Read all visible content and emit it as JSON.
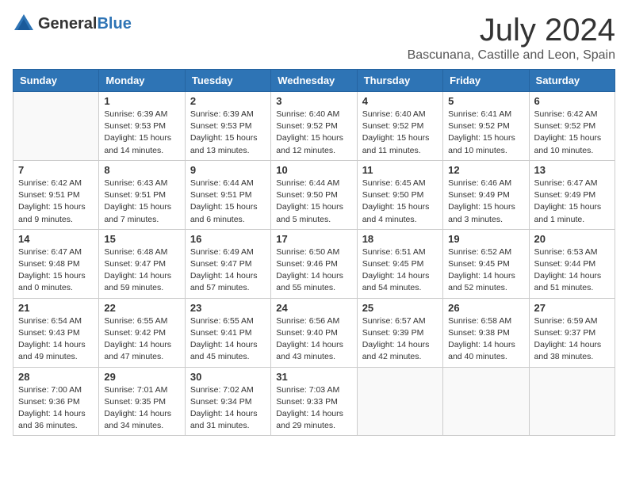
{
  "logo": {
    "general": "General",
    "blue": "Blue"
  },
  "title": {
    "month": "July 2024",
    "location": "Bascunana, Castille and Leon, Spain"
  },
  "days_of_week": [
    "Sunday",
    "Monday",
    "Tuesday",
    "Wednesday",
    "Thursday",
    "Friday",
    "Saturday"
  ],
  "weeks": [
    [
      {
        "day": "",
        "sunrise": "",
        "sunset": "",
        "daylight": ""
      },
      {
        "day": "1",
        "sunrise": "Sunrise: 6:39 AM",
        "sunset": "Sunset: 9:53 PM",
        "daylight": "Daylight: 15 hours and 14 minutes."
      },
      {
        "day": "2",
        "sunrise": "Sunrise: 6:39 AM",
        "sunset": "Sunset: 9:53 PM",
        "daylight": "Daylight: 15 hours and 13 minutes."
      },
      {
        "day": "3",
        "sunrise": "Sunrise: 6:40 AM",
        "sunset": "Sunset: 9:52 PM",
        "daylight": "Daylight: 15 hours and 12 minutes."
      },
      {
        "day": "4",
        "sunrise": "Sunrise: 6:40 AM",
        "sunset": "Sunset: 9:52 PM",
        "daylight": "Daylight: 15 hours and 11 minutes."
      },
      {
        "day": "5",
        "sunrise": "Sunrise: 6:41 AM",
        "sunset": "Sunset: 9:52 PM",
        "daylight": "Daylight: 15 hours and 10 minutes."
      },
      {
        "day": "6",
        "sunrise": "Sunrise: 6:42 AM",
        "sunset": "Sunset: 9:52 PM",
        "daylight": "Daylight: 15 hours and 10 minutes."
      }
    ],
    [
      {
        "day": "7",
        "sunrise": "Sunrise: 6:42 AM",
        "sunset": "Sunset: 9:51 PM",
        "daylight": "Daylight: 15 hours and 9 minutes."
      },
      {
        "day": "8",
        "sunrise": "Sunrise: 6:43 AM",
        "sunset": "Sunset: 9:51 PM",
        "daylight": "Daylight: 15 hours and 7 minutes."
      },
      {
        "day": "9",
        "sunrise": "Sunrise: 6:44 AM",
        "sunset": "Sunset: 9:51 PM",
        "daylight": "Daylight: 15 hours and 6 minutes."
      },
      {
        "day": "10",
        "sunrise": "Sunrise: 6:44 AM",
        "sunset": "Sunset: 9:50 PM",
        "daylight": "Daylight: 15 hours and 5 minutes."
      },
      {
        "day": "11",
        "sunrise": "Sunrise: 6:45 AM",
        "sunset": "Sunset: 9:50 PM",
        "daylight": "Daylight: 15 hours and 4 minutes."
      },
      {
        "day": "12",
        "sunrise": "Sunrise: 6:46 AM",
        "sunset": "Sunset: 9:49 PM",
        "daylight": "Daylight: 15 hours and 3 minutes."
      },
      {
        "day": "13",
        "sunrise": "Sunrise: 6:47 AM",
        "sunset": "Sunset: 9:49 PM",
        "daylight": "Daylight: 15 hours and 1 minute."
      }
    ],
    [
      {
        "day": "14",
        "sunrise": "Sunrise: 6:47 AM",
        "sunset": "Sunset: 9:48 PM",
        "daylight": "Daylight: 15 hours and 0 minutes."
      },
      {
        "day": "15",
        "sunrise": "Sunrise: 6:48 AM",
        "sunset": "Sunset: 9:47 PM",
        "daylight": "Daylight: 14 hours and 59 minutes."
      },
      {
        "day": "16",
        "sunrise": "Sunrise: 6:49 AM",
        "sunset": "Sunset: 9:47 PM",
        "daylight": "Daylight: 14 hours and 57 minutes."
      },
      {
        "day": "17",
        "sunrise": "Sunrise: 6:50 AM",
        "sunset": "Sunset: 9:46 PM",
        "daylight": "Daylight: 14 hours and 55 minutes."
      },
      {
        "day": "18",
        "sunrise": "Sunrise: 6:51 AM",
        "sunset": "Sunset: 9:45 PM",
        "daylight": "Daylight: 14 hours and 54 minutes."
      },
      {
        "day": "19",
        "sunrise": "Sunrise: 6:52 AM",
        "sunset": "Sunset: 9:45 PM",
        "daylight": "Daylight: 14 hours and 52 minutes."
      },
      {
        "day": "20",
        "sunrise": "Sunrise: 6:53 AM",
        "sunset": "Sunset: 9:44 PM",
        "daylight": "Daylight: 14 hours and 51 minutes."
      }
    ],
    [
      {
        "day": "21",
        "sunrise": "Sunrise: 6:54 AM",
        "sunset": "Sunset: 9:43 PM",
        "daylight": "Daylight: 14 hours and 49 minutes."
      },
      {
        "day": "22",
        "sunrise": "Sunrise: 6:55 AM",
        "sunset": "Sunset: 9:42 PM",
        "daylight": "Daylight: 14 hours and 47 minutes."
      },
      {
        "day": "23",
        "sunrise": "Sunrise: 6:55 AM",
        "sunset": "Sunset: 9:41 PM",
        "daylight": "Daylight: 14 hours and 45 minutes."
      },
      {
        "day": "24",
        "sunrise": "Sunrise: 6:56 AM",
        "sunset": "Sunset: 9:40 PM",
        "daylight": "Daylight: 14 hours and 43 minutes."
      },
      {
        "day": "25",
        "sunrise": "Sunrise: 6:57 AM",
        "sunset": "Sunset: 9:39 PM",
        "daylight": "Daylight: 14 hours and 42 minutes."
      },
      {
        "day": "26",
        "sunrise": "Sunrise: 6:58 AM",
        "sunset": "Sunset: 9:38 PM",
        "daylight": "Daylight: 14 hours and 40 minutes."
      },
      {
        "day": "27",
        "sunrise": "Sunrise: 6:59 AM",
        "sunset": "Sunset: 9:37 PM",
        "daylight": "Daylight: 14 hours and 38 minutes."
      }
    ],
    [
      {
        "day": "28",
        "sunrise": "Sunrise: 7:00 AM",
        "sunset": "Sunset: 9:36 PM",
        "daylight": "Daylight: 14 hours and 36 minutes."
      },
      {
        "day": "29",
        "sunrise": "Sunrise: 7:01 AM",
        "sunset": "Sunset: 9:35 PM",
        "daylight": "Daylight: 14 hours and 34 minutes."
      },
      {
        "day": "30",
        "sunrise": "Sunrise: 7:02 AM",
        "sunset": "Sunset: 9:34 PM",
        "daylight": "Daylight: 14 hours and 31 minutes."
      },
      {
        "day": "31",
        "sunrise": "Sunrise: 7:03 AM",
        "sunset": "Sunset: 9:33 PM",
        "daylight": "Daylight: 14 hours and 29 minutes."
      },
      {
        "day": "",
        "sunrise": "",
        "sunset": "",
        "daylight": ""
      },
      {
        "day": "",
        "sunrise": "",
        "sunset": "",
        "daylight": ""
      },
      {
        "day": "",
        "sunrise": "",
        "sunset": "",
        "daylight": ""
      }
    ]
  ]
}
